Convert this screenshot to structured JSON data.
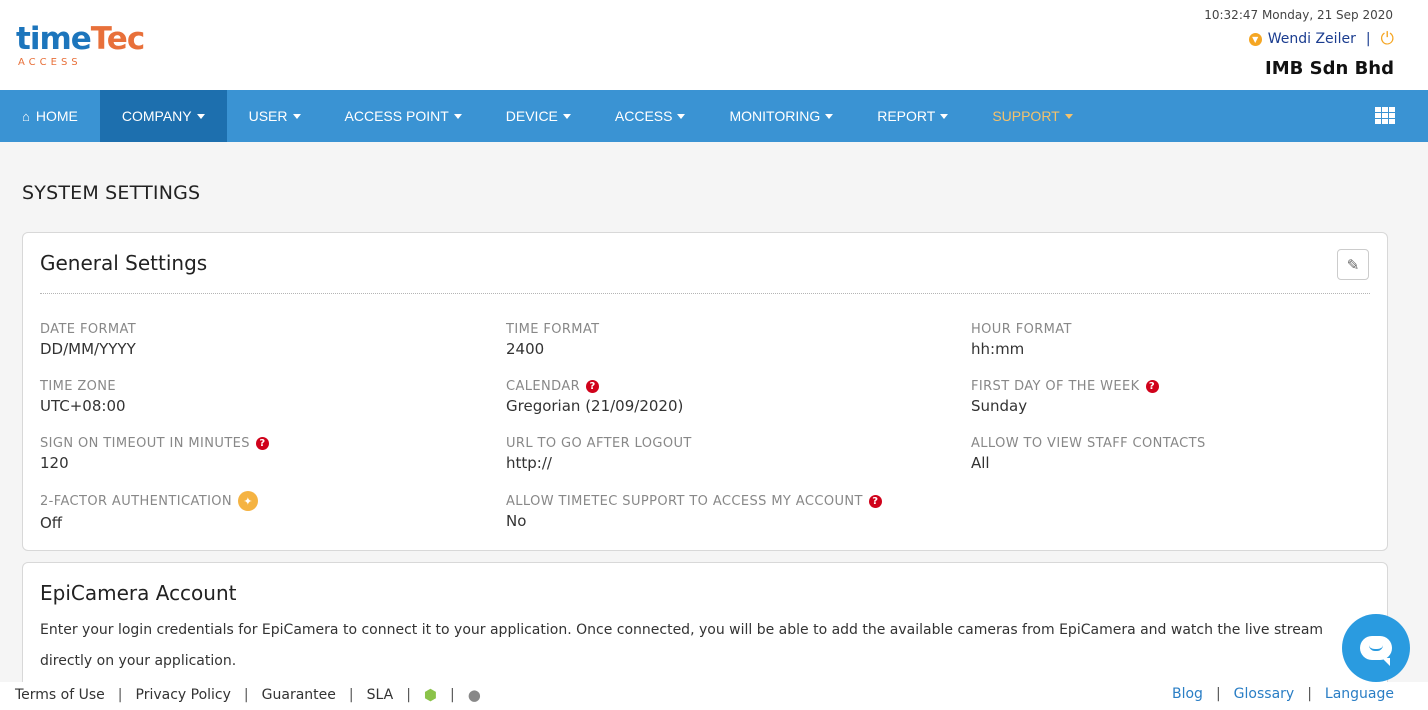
{
  "header": {
    "logo_main_a": "time",
    "logo_main_b": "Tec",
    "logo_sub": "ACCESS",
    "datetime": "10:32:47 Monday, 21 Sep 2020",
    "user_name": "Wendi Zeiler",
    "separator": "|",
    "company": "IMB Sdn Bhd"
  },
  "nav": {
    "items": [
      {
        "label": "HOME"
      },
      {
        "label": "COMPANY"
      },
      {
        "label": "USER"
      },
      {
        "label": "ACCESS POINT"
      },
      {
        "label": "DEVICE"
      },
      {
        "label": "ACCESS"
      },
      {
        "label": "MONITORING"
      },
      {
        "label": "REPORT"
      },
      {
        "label": "SUPPORT"
      }
    ],
    "active": "COMPANY",
    "bg_color": "#3a93d3",
    "active_color": "#1d6fae",
    "highlight_color": "#f4c26b"
  },
  "page": {
    "title": "SYSTEM SETTINGS"
  },
  "general": {
    "title": "General Settings",
    "fields": [
      {
        "label": "DATE FORMAT",
        "value": "DD/MM/YYYY"
      },
      {
        "label": "TIME FORMAT",
        "value": "2400"
      },
      {
        "label": "HOUR FORMAT",
        "value": "hh:mm"
      },
      {
        "label": "TIME ZONE",
        "value": "UTC+08:00"
      },
      {
        "label": "CALENDAR",
        "value": "Gregorian (21/09/2020)"
      },
      {
        "label": "FIRST DAY OF THE WEEK",
        "value": "Sunday"
      },
      {
        "label": "SIGN ON TIMEOUT IN MINUTES",
        "value": "120"
      },
      {
        "label": "URL TO GO AFTER LOGOUT",
        "value": "http://"
      },
      {
        "label": "ALLOW TO VIEW STAFF CONTACTS",
        "value": "All"
      },
      {
        "label": "2-FACTOR AUTHENTICATION",
        "value": "Off"
      },
      {
        "label": "ALLOW TIMETEC SUPPORT TO ACCESS MY ACCOUNT",
        "value": "No"
      }
    ]
  },
  "epicamera": {
    "title": "EpiCamera Account",
    "description": "Enter your login credentials for EpiCamera to connect it to your application. Once connected, you will be able to add the available cameras from EpiCamera and watch the live stream directly on your application."
  },
  "footer": {
    "left_links": [
      "Terms of Use",
      "Privacy Policy",
      "Guarantee",
      "SLA"
    ],
    "right_links": [
      "Blog",
      "Glossary",
      "Language"
    ],
    "separator": "|"
  }
}
